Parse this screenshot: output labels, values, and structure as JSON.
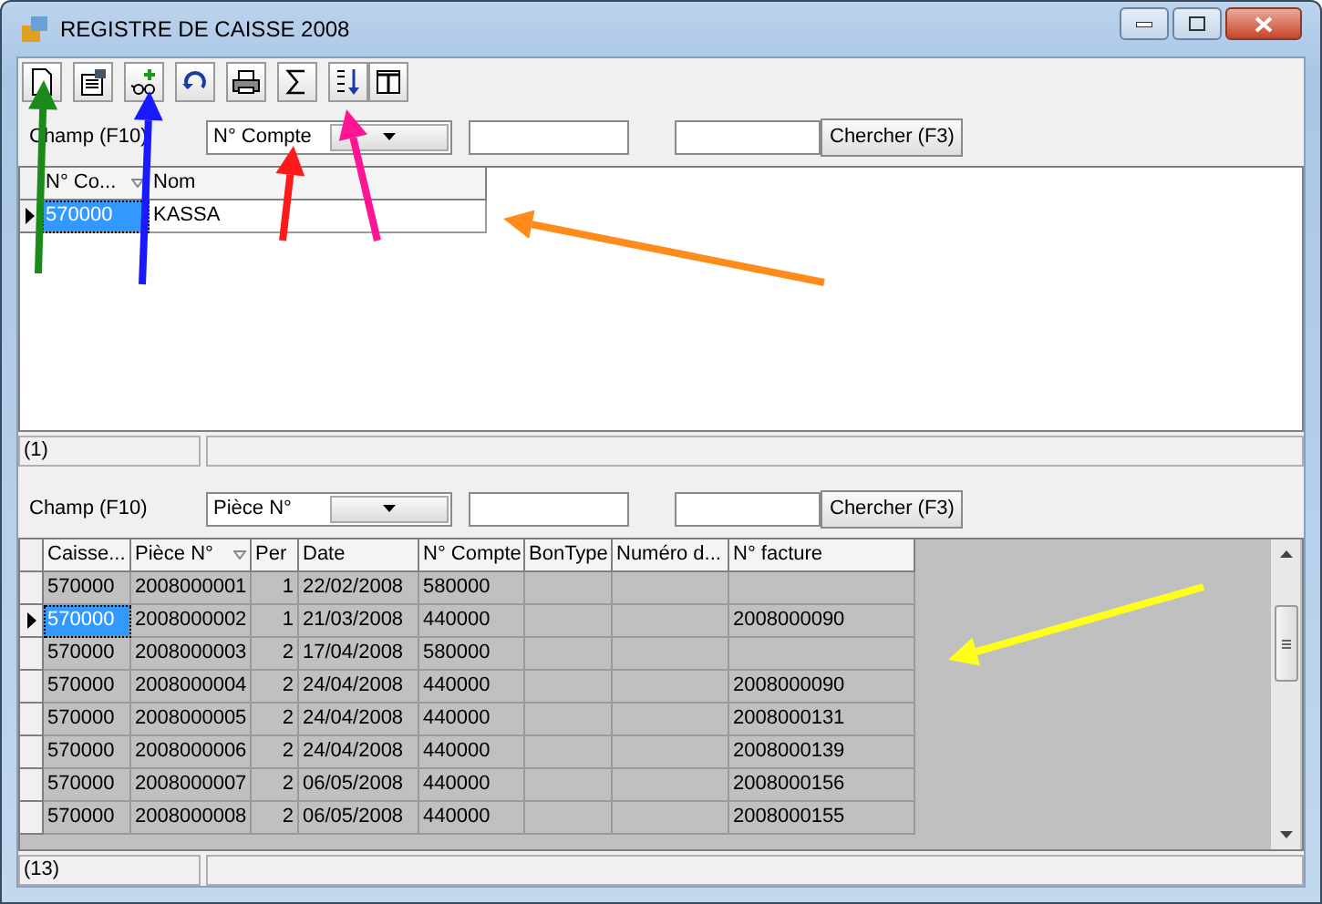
{
  "window": {
    "title": "REGISTRE DE CAISSE 2008"
  },
  "top": {
    "filter": {
      "label": "Champ (F10)",
      "field": "N° Compte",
      "search_button": "Chercher (F3)"
    },
    "columns": [
      {
        "label": "N° Co...",
        "sorted": true
      },
      {
        "label": "Nom",
        "sorted": false
      }
    ],
    "rows": [
      {
        "selected": true,
        "cells": [
          "570000",
          "KASSA"
        ]
      }
    ],
    "status": "(1)"
  },
  "bottom": {
    "filter": {
      "label": "Champ (F10)",
      "field": "Pièce N°",
      "search_button": "Chercher (F3)"
    },
    "columns": [
      {
        "label": "Caisse...",
        "sorted": false,
        "kind": "text"
      },
      {
        "label": "Pièce N°",
        "sorted": true,
        "kind": "text"
      },
      {
        "label": "Per",
        "sorted": false,
        "kind": "number"
      },
      {
        "label": "Date",
        "sorted": false,
        "kind": "text"
      },
      {
        "label": "N° Compte",
        "sorted": false,
        "kind": "text"
      },
      {
        "label": "BonType",
        "sorted": false,
        "kind": "text"
      },
      {
        "label": "Numéro d...",
        "sorted": false,
        "kind": "text"
      },
      {
        "label": "N° facture",
        "sorted": false,
        "kind": "text"
      }
    ],
    "rows": [
      {
        "selected": false,
        "cells": [
          "570000",
          "2008000001",
          "1",
          "22/02/2008",
          "580000",
          "",
          "",
          ""
        ]
      },
      {
        "selected": true,
        "cells": [
          "570000",
          "2008000002",
          "1",
          "21/03/2008",
          "440000",
          "",
          "",
          "2008000090"
        ]
      },
      {
        "selected": false,
        "cells": [
          "570000",
          "2008000003",
          "2",
          "17/04/2008",
          "580000",
          "",
          "",
          ""
        ]
      },
      {
        "selected": false,
        "cells": [
          "570000",
          "2008000004",
          "2",
          "24/04/2008",
          "440000",
          "",
          "",
          "2008000090"
        ]
      },
      {
        "selected": false,
        "cells": [
          "570000",
          "2008000005",
          "2",
          "24/04/2008",
          "440000",
          "",
          "",
          "2008000131"
        ]
      },
      {
        "selected": false,
        "cells": [
          "570000",
          "2008000006",
          "2",
          "24/04/2008",
          "440000",
          "",
          "",
          "2008000139"
        ]
      },
      {
        "selected": false,
        "cells": [
          "570000",
          "2008000007",
          "2",
          "06/05/2008",
          "440000",
          "",
          "",
          "2008000156"
        ]
      },
      {
        "selected": false,
        "cells": [
          "570000",
          "2008000008",
          "2",
          "06/05/2008",
          "440000",
          "",
          "",
          "2008000155"
        ]
      }
    ],
    "status": "(13)"
  },
  "annotations": [
    {
      "color": "#1a8a1a"
    },
    {
      "color": "#1a1aff"
    },
    {
      "color": "#ff1a1a"
    },
    {
      "color": "#ff1493"
    },
    {
      "color": "#ff8c1a"
    },
    {
      "color": "#ffff1a"
    }
  ]
}
